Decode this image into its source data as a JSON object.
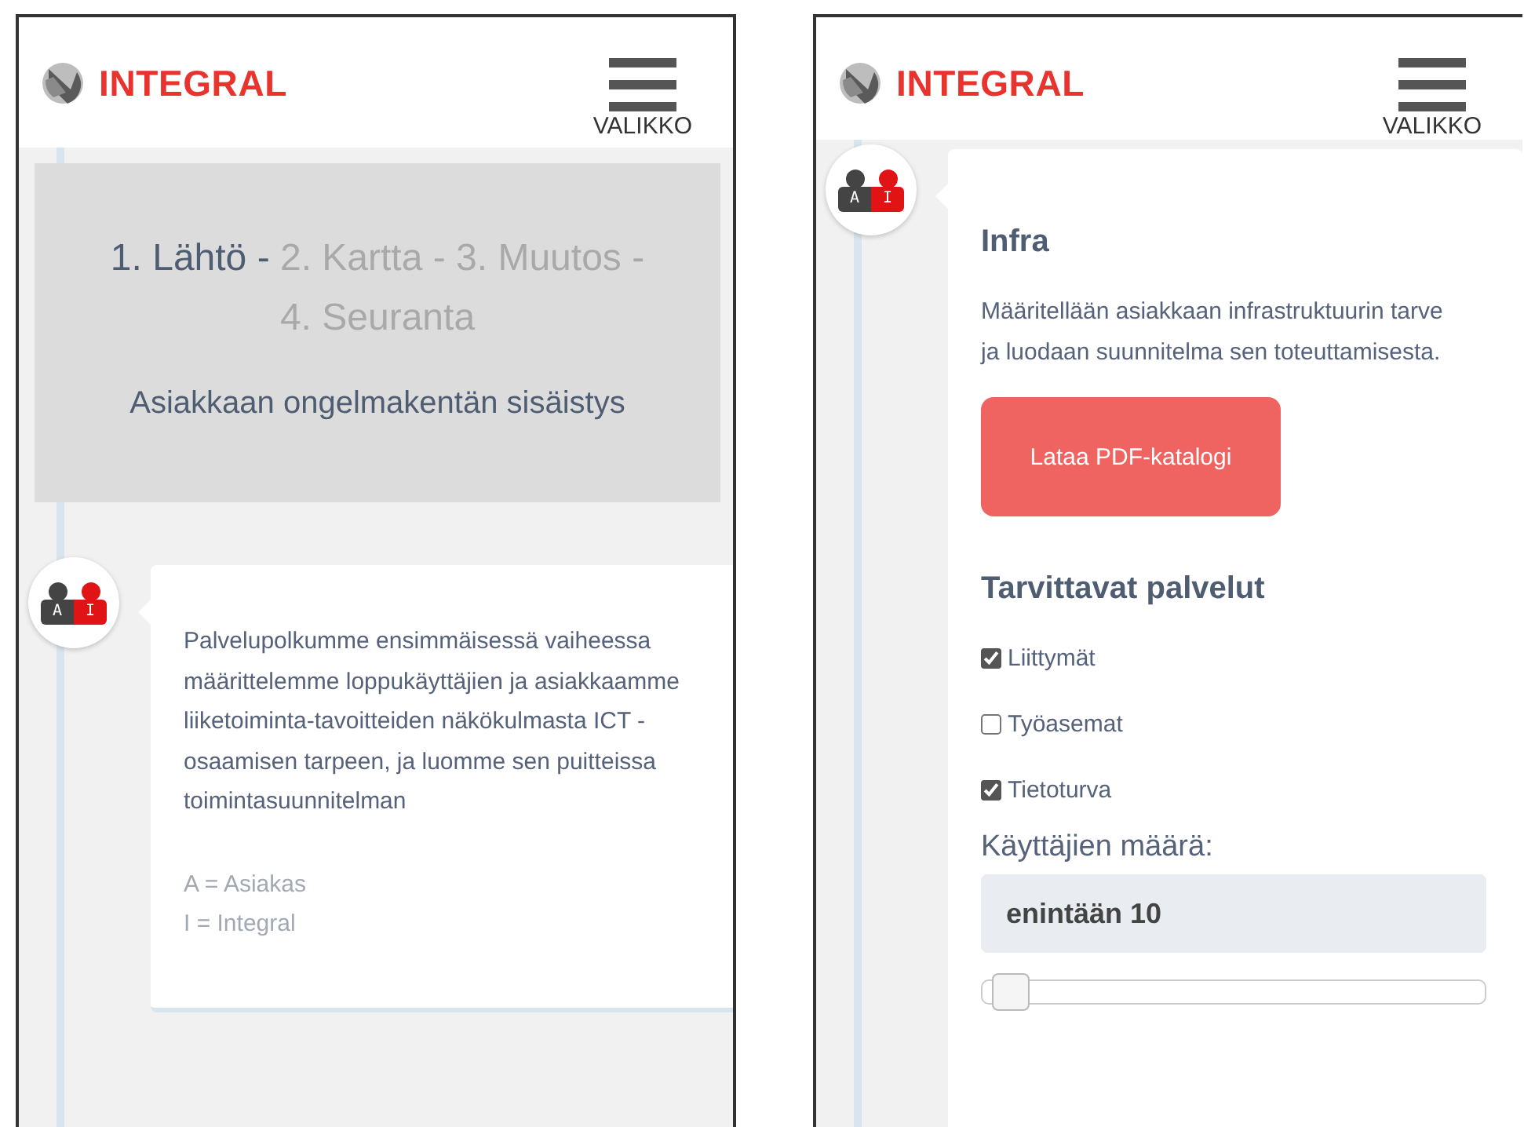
{
  "screens": [
    {
      "kind": "journey",
      "header": {
        "logo": "INTEGRAL",
        "menu_label": "VALIKKO"
      },
      "steps": [
        {
          "label": "1. Lähtö -",
          "active": true
        },
        {
          "label": "2. Kartta -",
          "active": false
        },
        {
          "label": "3. Muutos -",
          "active": false
        },
        {
          "label": "4. Seuranta",
          "active": false
        }
      ],
      "subtitle": "Asiakkaan ongelmakentän sisäistys",
      "avatar": {
        "left_letter": "A",
        "right_letter": "I"
      },
      "card": {
        "text": "Palvelupolkumme ensimmäisessä vaiheessa määrittelemme loppukäyttäjien ja asiakkaamme liiketoiminta-tavoitteiden näkökulmasta ICT -osaamisen tarpeen, ja luomme sen puitteissa toimintasuunnitelman",
        "legend": [
          "A = Asiakas",
          "I = Integral"
        ]
      }
    },
    {
      "kind": "form",
      "header": {
        "logo": "INTEGRAL",
        "menu_label": "VALIKKO"
      },
      "avatar": {
        "left_letter": "A",
        "right_letter": "I"
      },
      "card": {
        "title": "Infra",
        "text": "Määritellään asiakkaan infrastruktuurin tarve ja luodaan suunnitelma sen toteuttamisesta.",
        "button": "Lataa PDF-katalogi",
        "services_title": "Tarvittavat palvelut",
        "services": [
          {
            "label": "Liittymät",
            "checked": true
          },
          {
            "label": "Työasemat",
            "checked": false
          },
          {
            "label": "Tietoturva",
            "checked": true
          }
        ],
        "users_label": "Käyttäjien määrä:",
        "users_value": "enintään 10",
        "users_slider": {
          "level": 0.02
        }
      }
    }
  ]
}
